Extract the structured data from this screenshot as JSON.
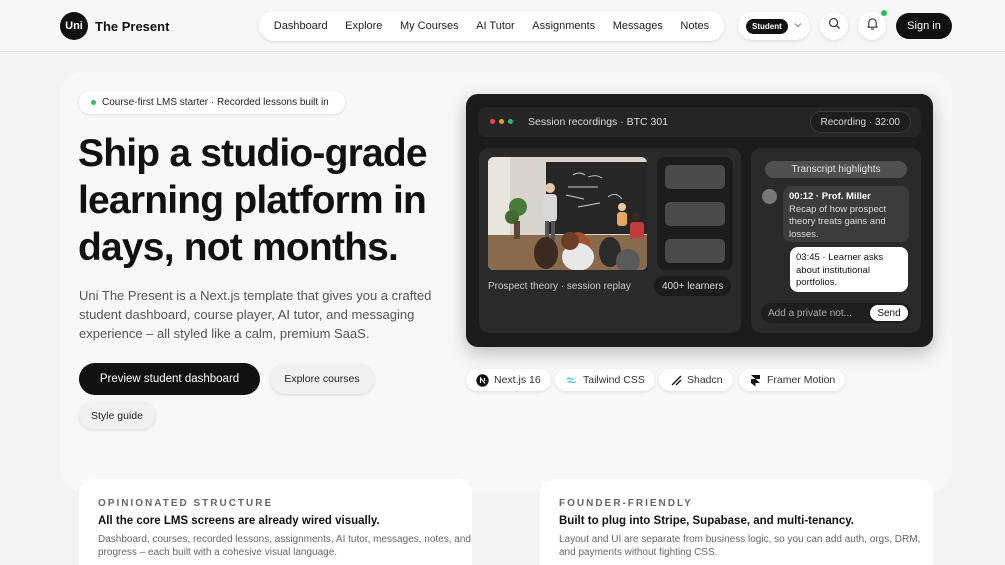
{
  "brand": {
    "logo_text": "Uni",
    "name": "The Present"
  },
  "nav": {
    "items": [
      {
        "label": "Dashboard"
      },
      {
        "label": "Explore"
      },
      {
        "label": "My Courses"
      },
      {
        "label": "AI Tutor"
      },
      {
        "label": "Assignments"
      },
      {
        "label": "Messages"
      },
      {
        "label": "Notes"
      }
    ]
  },
  "header": {
    "role_label": "Student",
    "signin_label": "Sign in",
    "icons": [
      "search-icon",
      "bell-icon",
      "chevron-down-icon"
    ],
    "notification_color": "#22c55e"
  },
  "hero": {
    "badge": "Course-first LMS starter · Recorded lessons built in",
    "title": "Ship a studio-grade learning platform in days, not months.",
    "description": "Uni The Present is a Next.js template that gives you a crafted student dashboard, course player, AI tutor, and messaging experience – all styled like a calm, premium SaaS.",
    "primary_button": "Preview student dashboard",
    "secondary_button": "Explore courses",
    "style_guide_button": "Style guide"
  },
  "recording": {
    "title": "Session recordings · BTC 301",
    "status": "Recording · 32:00",
    "caption": "Prospect theory · session replay",
    "learners": "400+ learners",
    "transcript_title": "Transcript highlights",
    "message_1_time": "00:12 · Prof. Miller",
    "message_1_text": "Recap of how prospect theory treats gains and losses.",
    "message_2_text": "03:45 · Learner asks about institutional portfolios.",
    "input_placeholder": "Add a private not...",
    "send_label": "Send",
    "window_dot_colors": [
      "#ef4444",
      "#f59e0b",
      "#22c55e"
    ]
  },
  "tech": [
    {
      "label": "Next.js 16",
      "icon": "nextjs-icon"
    },
    {
      "label": "Tailwind CSS",
      "icon": "tailwind-icon"
    },
    {
      "label": "Shadcn",
      "icon": "shadcn-icon"
    },
    {
      "label": "Framer Motion",
      "icon": "framer-icon"
    }
  ],
  "features": [
    {
      "kicker": "OPINIONATED STRUCTURE",
      "title": "All the core LMS screens are already wired visually.",
      "description": "Dashboard, courses, recorded lessons, assignments, AI tutor, messages, notes, and progress – each built with a cohesive visual language."
    },
    {
      "kicker": "FOUNDER-FRIENDLY",
      "title": "Built to plug into Stripe, Supabase, and multi-tenancy.",
      "description": "Layout and UI are separate from business logic, so you can add auth, orgs, DRM, and payments without fighting CSS."
    }
  ]
}
